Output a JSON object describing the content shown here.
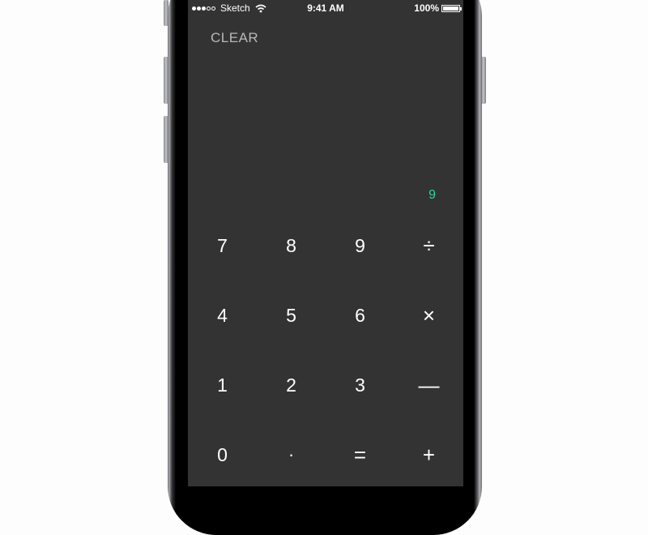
{
  "status_bar": {
    "signal_strength": 3,
    "signal_max": 5,
    "carrier": "Sketch",
    "time": "9:41 AM",
    "battery_percent": "100%",
    "battery_level": 1.0
  },
  "calculator": {
    "clear_label": "CLEAR",
    "display_value": "9",
    "accent_color": "#2ed59a",
    "background_color": "#333333",
    "keys": [
      {
        "label": "7",
        "type": "digit"
      },
      {
        "label": "8",
        "type": "digit"
      },
      {
        "label": "9",
        "type": "digit"
      },
      {
        "label": "÷",
        "type": "operator",
        "name": "divide"
      },
      {
        "label": "4",
        "type": "digit"
      },
      {
        "label": "5",
        "type": "digit"
      },
      {
        "label": "6",
        "type": "digit"
      },
      {
        "label": "×",
        "type": "operator",
        "name": "multiply"
      },
      {
        "label": "1",
        "type": "digit"
      },
      {
        "label": "2",
        "type": "digit"
      },
      {
        "label": "3",
        "type": "digit"
      },
      {
        "label": "—",
        "type": "operator",
        "name": "subtract"
      },
      {
        "label": "0",
        "type": "digit"
      },
      {
        "label": "·",
        "type": "decimal",
        "name": "decimal"
      },
      {
        "label": "=",
        "type": "operator",
        "name": "equals"
      },
      {
        "label": "+",
        "type": "operator",
        "name": "add"
      }
    ]
  }
}
